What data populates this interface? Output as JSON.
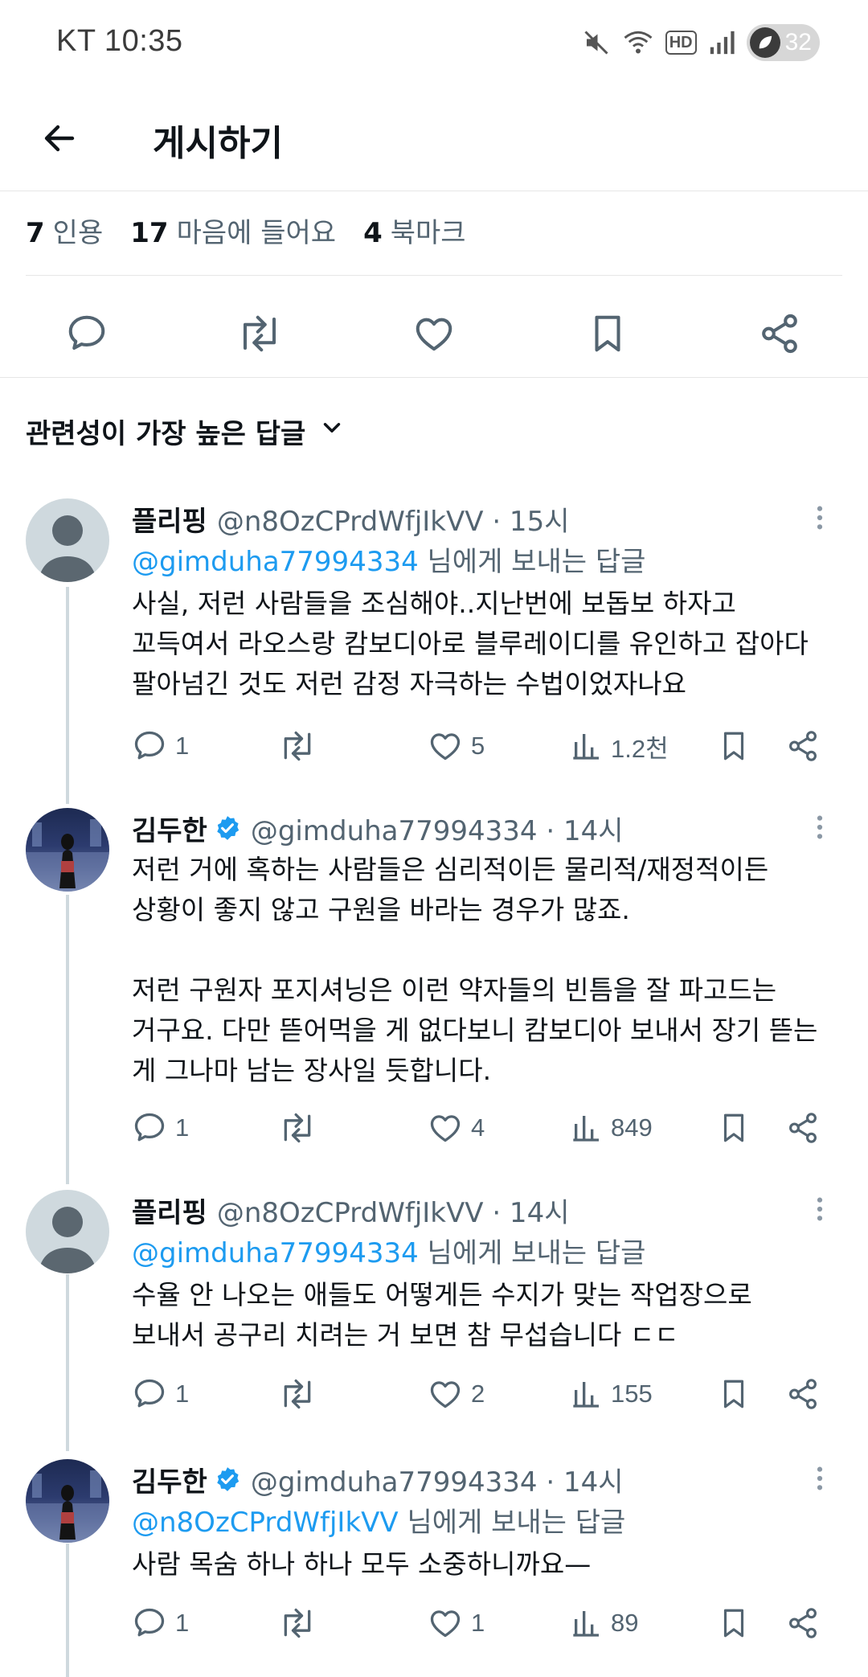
{
  "status_bar": {
    "carrier_time": "KT 10:35",
    "network": "HD",
    "battery": "32"
  },
  "header": {
    "title": "게시하기"
  },
  "stats": [
    {
      "count": "7",
      "label": "인용"
    },
    {
      "count": "17",
      "label": "마음에 들어요"
    },
    {
      "count": "4",
      "label": "북마크"
    }
  ],
  "action_icons": [
    "reply-icon",
    "retweet-icon",
    "like-icon",
    "bookmark-icon",
    "share-icon"
  ],
  "sort": {
    "label": "관련성이 가장 높은 답글"
  },
  "replies": [
    {
      "name": "플리핑",
      "handle": "@n8OzCPrdWfjIkVV · 15시",
      "verified": false,
      "reply_to_mention": "@gimduha77994334",
      "reply_to_suffix": " 님에게 보내는 답글",
      "text": "사실, 저런 사람들을 조심해야..지난번에 보돕보 하자고\n꼬득여서 라오스랑 캄보디아로 블루레이디를 유인하고 잡아다\n팔아넘긴 것도 저런 감정 자극하는 수법이었자나요",
      "replies": "1",
      "retweets": "",
      "likes": "5",
      "views": "1.2천"
    },
    {
      "name": "김두한",
      "handle": "@gimduha77994334 · 14시",
      "verified": true,
      "reply_to_mention": "",
      "reply_to_suffix": "",
      "text": "저런 거에 혹하는 사람들은 심리적이든 물리적/재정적이든\n상황이 좋지 않고 구원을 바라는 경우가 많죠.\n\n저런 구원자 포지셔닝은 이런 약자들의 빈틈을 잘 파고드는\n거구요. 다만 뜯어먹을 게 없다보니 캄보디아 보내서 장기 뜯는\n게 그나마 남는 장사일 듯합니다.",
      "replies": "1",
      "retweets": "",
      "likes": "4",
      "views": "849"
    },
    {
      "name": "플리핑",
      "handle": "@n8OzCPrdWfjIkVV · 14시",
      "verified": false,
      "reply_to_mention": "@gimduha77994334",
      "reply_to_suffix": " 님에게 보내는 답글",
      "text": "수율 안 나오는 애들도 어떻게든 수지가 맞는 작업장으로\n보내서 공구리 치려는 거 보면 참 무섭습니다 ㄷㄷ",
      "replies": "1",
      "retweets": "",
      "likes": "2",
      "views": "155"
    },
    {
      "name": "김두한",
      "handle": "@gimduha77994334 · 14시",
      "verified": true,
      "reply_to_mention": "@n8OzCPrdWfjIkVV",
      "reply_to_suffix": " 님에게 보내는 답글",
      "text": "사람 목숨 하나 하나 모두 소중하니까요—",
      "replies": "1",
      "retweets": "",
      "likes": "1",
      "views": "89"
    }
  ],
  "colors": {
    "accent": "#1d9bf0",
    "muted": "#536471",
    "text": "#0f1419",
    "divider": "#e6e6e6"
  }
}
